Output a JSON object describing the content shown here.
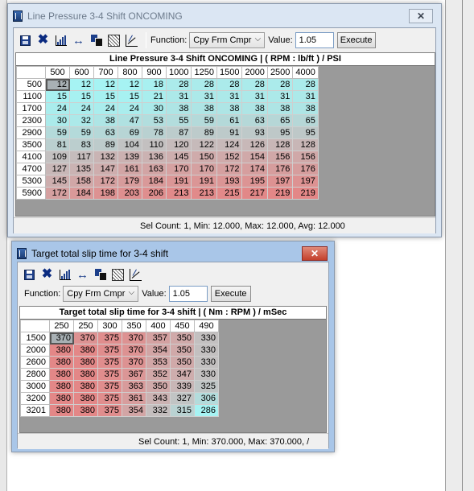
{
  "win1": {
    "title": "Line Pressure 3-4 Shift ONCOMING",
    "close_label": "✕",
    "toolbar": {
      "function_label": "Function:",
      "function_value": "Cpy Frm Cmpr",
      "value_label": "Value:",
      "value_input": "1.05",
      "execute_label": "Execute"
    },
    "grid": {
      "title": "Line Pressure 3-4 Shift ONCOMING |   ( RPM : lb/ft ) / PSI",
      "col_headers": [
        "500",
        "600",
        "700",
        "800",
        "900",
        "1000",
        "1250",
        "1500",
        "2000",
        "2500",
        "4000"
      ],
      "row_headers": [
        "500",
        "1100",
        "1700",
        "2300",
        "2900",
        "3500",
        "4100",
        "4700",
        "5300",
        "5900"
      ],
      "values": [
        [
          "12",
          "12",
          "12",
          "12",
          "18",
          "28",
          "28",
          "28",
          "28",
          "28",
          "28"
        ],
        [
          "15",
          "15",
          "15",
          "15",
          "21",
          "31",
          "31",
          "31",
          "31",
          "31",
          "31"
        ],
        [
          "24",
          "24",
          "24",
          "24",
          "30",
          "38",
          "38",
          "38",
          "38",
          "38",
          "38"
        ],
        [
          "30",
          "32",
          "38",
          "47",
          "53",
          "55",
          "59",
          "61",
          "63",
          "65",
          "65"
        ],
        [
          "59",
          "59",
          "63",
          "69",
          "78",
          "87",
          "89",
          "91",
          "93",
          "95",
          "95"
        ],
        [
          "81",
          "83",
          "89",
          "104",
          "110",
          "120",
          "122",
          "124",
          "126",
          "128",
          "128"
        ],
        [
          "109",
          "117",
          "132",
          "139",
          "136",
          "145",
          "150",
          "152",
          "154",
          "156",
          "156"
        ],
        [
          "127",
          "135",
          "147",
          "161",
          "163",
          "170",
          "170",
          "172",
          "174",
          "176",
          "176"
        ],
        [
          "145",
          "158",
          "172",
          "179",
          "184",
          "191",
          "191",
          "193",
          "195",
          "197",
          "197"
        ],
        [
          "172",
          "184",
          "198",
          "203",
          "206",
          "213",
          "213",
          "215",
          "217",
          "219",
          "219"
        ]
      ]
    },
    "status": "Sel Count: 1, Min: 12.000, Max: 12.000, Avg: 12.000"
  },
  "win2": {
    "title": "Target total slip time for 3-4 shift",
    "close_label": "✕",
    "toolbar": {
      "function_label": "Function:",
      "function_value": "Cpy Frm Cmpr",
      "value_label": "Value:",
      "value_input": "1.05",
      "execute_label": "Execute"
    },
    "grid": {
      "title": "Target total slip time for 3-4 shift |   ( Nm : RPM ) / mSec",
      "col_headers": [
        "250",
        "250",
        "300",
        "350",
        "400",
        "450",
        "490"
      ],
      "row_headers": [
        "1500",
        "2000",
        "2600",
        "2800",
        "3000",
        "3200",
        "3201"
      ],
      "values": [
        [
          "370",
          "370",
          "375",
          "370",
          "357",
          "350",
          "330"
        ],
        [
          "380",
          "380",
          "375",
          "370",
          "354",
          "350",
          "330"
        ],
        [
          "380",
          "380",
          "375",
          "370",
          "353",
          "350",
          "330"
        ],
        [
          "380",
          "380",
          "375",
          "367",
          "352",
          "347",
          "330"
        ],
        [
          "380",
          "380",
          "375",
          "363",
          "350",
          "339",
          "325"
        ],
        [
          "380",
          "380",
          "375",
          "361",
          "343",
          "327",
          "306"
        ],
        [
          "380",
          "380",
          "375",
          "354",
          "332",
          "315",
          "286"
        ]
      ]
    },
    "status": "Sel Count: 1, Min: 370.000, Max: 370.000, /"
  },
  "colors": {
    "heat_low": "#a6f3f3",
    "heat_high": "#e38787",
    "selected_cell": "#a8b0b4"
  }
}
